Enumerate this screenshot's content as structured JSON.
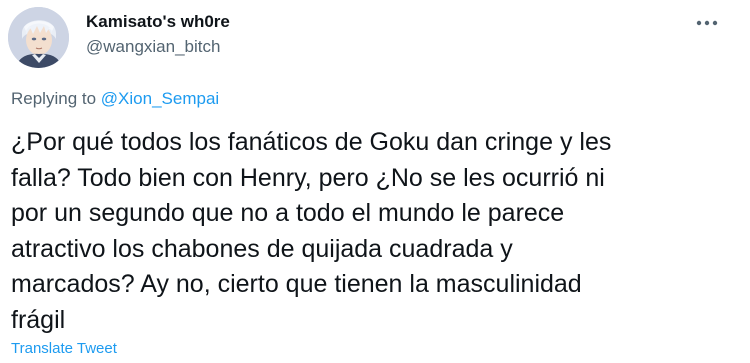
{
  "author": {
    "display_name": "Kamisato's wh0re",
    "handle": "@wangxian_bitch"
  },
  "reply": {
    "prefix": "Replying to",
    "mention": "@Xion_Sempai"
  },
  "tweet": {
    "text": "¿Por qué todos los fanáticos de Goku dan cringe y les\nfalla? Todo bien con Henry, pero ¿No se les ocurrió ni\npor un segundo que no a todo el mundo le parece\natractivo los chabones de quijada cuadrada y\nmarcados? Ay no, cierto que tienen la masculinidad\nfrágil"
  },
  "actions": {
    "translate_label": "Translate Tweet",
    "more_icon": "more-horizontal-icon"
  },
  "colors": {
    "text_primary": "#0f1419",
    "text_secondary": "#536471",
    "link": "#1d9bf0"
  }
}
